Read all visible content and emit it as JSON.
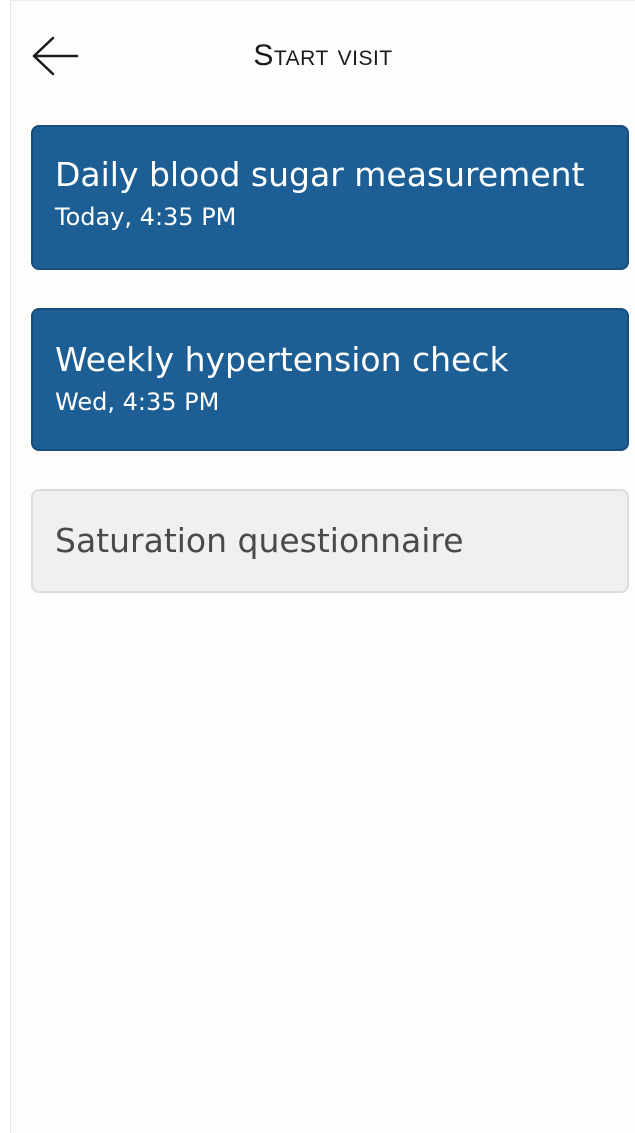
{
  "header": {
    "title": "Start visit",
    "back_icon": "arrow-left-icon"
  },
  "visits": [
    {
      "name": "Daily blood sugar measurement",
      "time": "Today, 4:35 PM",
      "state": "active"
    },
    {
      "name": "Weekly hypertension check",
      "time": "Wed, 4:35 PM",
      "state": "active"
    },
    {
      "name": "Saturation questionnaire",
      "state": "inactive"
    }
  ],
  "colors": {
    "card_active_bg": "#1d5f94",
    "card_inactive_bg": "#f0f0f0",
    "text_dark": "#1a1a1a"
  }
}
